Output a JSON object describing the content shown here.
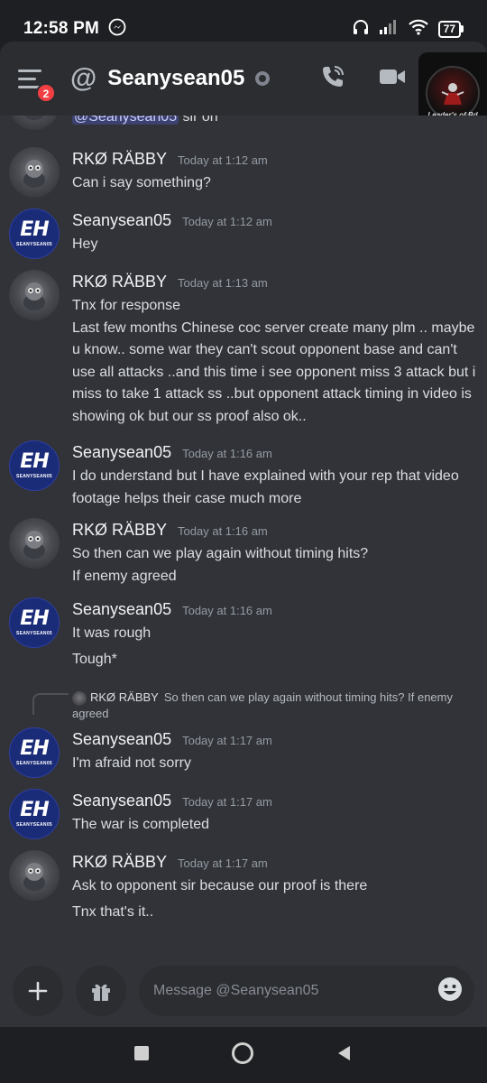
{
  "status_bar": {
    "time": "12:58 PM",
    "battery": "77"
  },
  "header": {
    "badge_count": "2",
    "title": "Seanysean05",
    "profile_label": "Leader's of Bd"
  },
  "messages": [
    {
      "author": "",
      "time": "",
      "lines": [],
      "mention": "@Seanysean05",
      "mention_tail": " sir on"
    },
    {
      "author": "RKØ RÄBBY",
      "time": "Today at 1:12 am",
      "lines": [
        "Can i say something?"
      ]
    },
    {
      "author": "Seanysean05",
      "time": "Today at 1:12 am",
      "lines": [
        "Hey"
      ]
    },
    {
      "author": "RKØ RÄBBY",
      "time": "Today at 1:13 am",
      "lines": [
        "Tnx for response",
        "Last few months Chinese coc server create many plm .. maybe u know.. some war they can't scout opponent base and can't use all attacks ..and this time i see opponent miss 3 attack but i miss to take 1 attack ss ..but opponent attack timing in video is showing ok but our ss proof also ok.."
      ]
    },
    {
      "author": "Seanysean05",
      "time": "Today at 1:16 am",
      "lines": [
        "I do understand but I have explained with your rep that video footage helps their case much more"
      ]
    },
    {
      "author": "RKØ RÄBBY",
      "time": "Today at 1:16 am",
      "lines": [
        "So then can we play again without timing hits?",
        "If enemy agreed"
      ]
    },
    {
      "author": "Seanysean05",
      "time": "Today at 1:16 am",
      "lines": [
        "It was rough",
        "Tough*"
      ]
    },
    {
      "author": "Seanysean05",
      "time": "Today at 1:17 am",
      "lines": [
        "I'm afraid not sorry"
      ]
    },
    {
      "author": "Seanysean05",
      "time": "Today at 1:17 am",
      "lines": [
        "The war is completed"
      ]
    },
    {
      "author": "RKØ RÄBBY",
      "time": "Today at 1:17 am",
      "lines": [
        "Ask to opponent sir because our proof is there",
        "Tnx that's it.."
      ]
    }
  ],
  "reply": {
    "author": "RKØ RÄBBY",
    "text": "So then can we play again without timing hits?  If enemy agreed"
  },
  "composer": {
    "placeholder": "Message @Seanysean05"
  },
  "avatars": {
    "rkø": "robot-avatar",
    "seany": "EH",
    "seany_sub": "SEANYSEAN05"
  },
  "colors": {
    "background": "#313338",
    "header": "#2b2d31",
    "mention_bg": "#3c4270",
    "badge": "#f23f43",
    "eh_avatar": "#1a2b78"
  }
}
